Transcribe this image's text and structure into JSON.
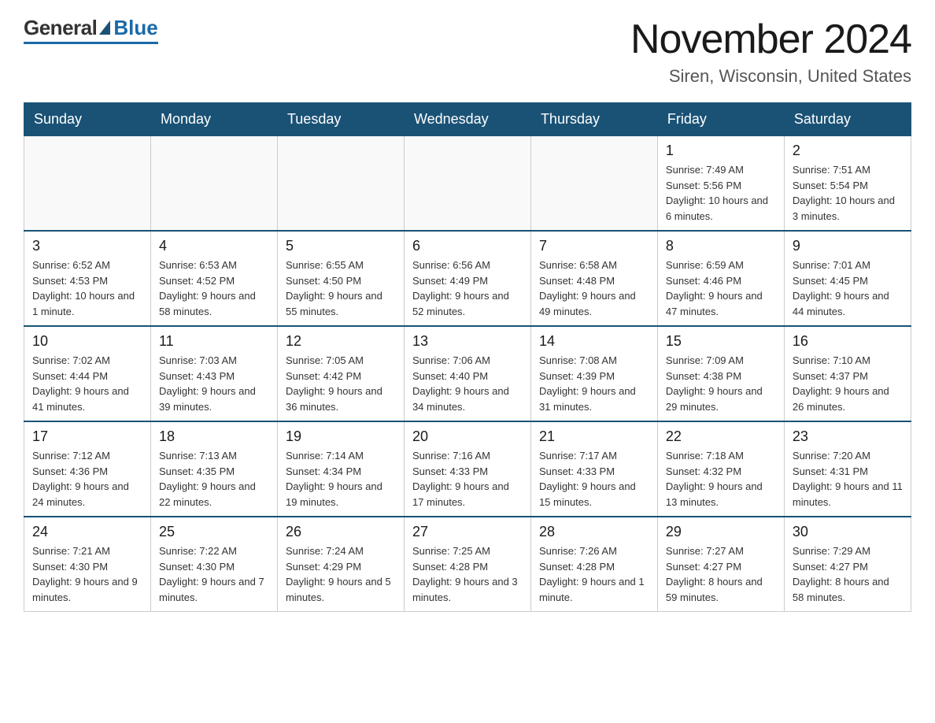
{
  "logo": {
    "general": "General",
    "blue": "Blue"
  },
  "header": {
    "month_year": "November 2024",
    "location": "Siren, Wisconsin, United States"
  },
  "weekdays": [
    "Sunday",
    "Monday",
    "Tuesday",
    "Wednesday",
    "Thursday",
    "Friday",
    "Saturday"
  ],
  "weeks": [
    [
      {
        "day": "",
        "info": ""
      },
      {
        "day": "",
        "info": ""
      },
      {
        "day": "",
        "info": ""
      },
      {
        "day": "",
        "info": ""
      },
      {
        "day": "",
        "info": ""
      },
      {
        "day": "1",
        "info": "Sunrise: 7:49 AM\nSunset: 5:56 PM\nDaylight: 10 hours and 6 minutes."
      },
      {
        "day": "2",
        "info": "Sunrise: 7:51 AM\nSunset: 5:54 PM\nDaylight: 10 hours and 3 minutes."
      }
    ],
    [
      {
        "day": "3",
        "info": "Sunrise: 6:52 AM\nSunset: 4:53 PM\nDaylight: 10 hours and 1 minute."
      },
      {
        "day": "4",
        "info": "Sunrise: 6:53 AM\nSunset: 4:52 PM\nDaylight: 9 hours and 58 minutes."
      },
      {
        "day": "5",
        "info": "Sunrise: 6:55 AM\nSunset: 4:50 PM\nDaylight: 9 hours and 55 minutes."
      },
      {
        "day": "6",
        "info": "Sunrise: 6:56 AM\nSunset: 4:49 PM\nDaylight: 9 hours and 52 minutes."
      },
      {
        "day": "7",
        "info": "Sunrise: 6:58 AM\nSunset: 4:48 PM\nDaylight: 9 hours and 49 minutes."
      },
      {
        "day": "8",
        "info": "Sunrise: 6:59 AM\nSunset: 4:46 PM\nDaylight: 9 hours and 47 minutes."
      },
      {
        "day": "9",
        "info": "Sunrise: 7:01 AM\nSunset: 4:45 PM\nDaylight: 9 hours and 44 minutes."
      }
    ],
    [
      {
        "day": "10",
        "info": "Sunrise: 7:02 AM\nSunset: 4:44 PM\nDaylight: 9 hours and 41 minutes."
      },
      {
        "day": "11",
        "info": "Sunrise: 7:03 AM\nSunset: 4:43 PM\nDaylight: 9 hours and 39 minutes."
      },
      {
        "day": "12",
        "info": "Sunrise: 7:05 AM\nSunset: 4:42 PM\nDaylight: 9 hours and 36 minutes."
      },
      {
        "day": "13",
        "info": "Sunrise: 7:06 AM\nSunset: 4:40 PM\nDaylight: 9 hours and 34 minutes."
      },
      {
        "day": "14",
        "info": "Sunrise: 7:08 AM\nSunset: 4:39 PM\nDaylight: 9 hours and 31 minutes."
      },
      {
        "day": "15",
        "info": "Sunrise: 7:09 AM\nSunset: 4:38 PM\nDaylight: 9 hours and 29 minutes."
      },
      {
        "day": "16",
        "info": "Sunrise: 7:10 AM\nSunset: 4:37 PM\nDaylight: 9 hours and 26 minutes."
      }
    ],
    [
      {
        "day": "17",
        "info": "Sunrise: 7:12 AM\nSunset: 4:36 PM\nDaylight: 9 hours and 24 minutes."
      },
      {
        "day": "18",
        "info": "Sunrise: 7:13 AM\nSunset: 4:35 PM\nDaylight: 9 hours and 22 minutes."
      },
      {
        "day": "19",
        "info": "Sunrise: 7:14 AM\nSunset: 4:34 PM\nDaylight: 9 hours and 19 minutes."
      },
      {
        "day": "20",
        "info": "Sunrise: 7:16 AM\nSunset: 4:33 PM\nDaylight: 9 hours and 17 minutes."
      },
      {
        "day": "21",
        "info": "Sunrise: 7:17 AM\nSunset: 4:33 PM\nDaylight: 9 hours and 15 minutes."
      },
      {
        "day": "22",
        "info": "Sunrise: 7:18 AM\nSunset: 4:32 PM\nDaylight: 9 hours and 13 minutes."
      },
      {
        "day": "23",
        "info": "Sunrise: 7:20 AM\nSunset: 4:31 PM\nDaylight: 9 hours and 11 minutes."
      }
    ],
    [
      {
        "day": "24",
        "info": "Sunrise: 7:21 AM\nSunset: 4:30 PM\nDaylight: 9 hours and 9 minutes."
      },
      {
        "day": "25",
        "info": "Sunrise: 7:22 AM\nSunset: 4:30 PM\nDaylight: 9 hours and 7 minutes."
      },
      {
        "day": "26",
        "info": "Sunrise: 7:24 AM\nSunset: 4:29 PM\nDaylight: 9 hours and 5 minutes."
      },
      {
        "day": "27",
        "info": "Sunrise: 7:25 AM\nSunset: 4:28 PM\nDaylight: 9 hours and 3 minutes."
      },
      {
        "day": "28",
        "info": "Sunrise: 7:26 AM\nSunset: 4:28 PM\nDaylight: 9 hours and 1 minute."
      },
      {
        "day": "29",
        "info": "Sunrise: 7:27 AM\nSunset: 4:27 PM\nDaylight: 8 hours and 59 minutes."
      },
      {
        "day": "30",
        "info": "Sunrise: 7:29 AM\nSunset: 4:27 PM\nDaylight: 8 hours and 58 minutes."
      }
    ]
  ]
}
